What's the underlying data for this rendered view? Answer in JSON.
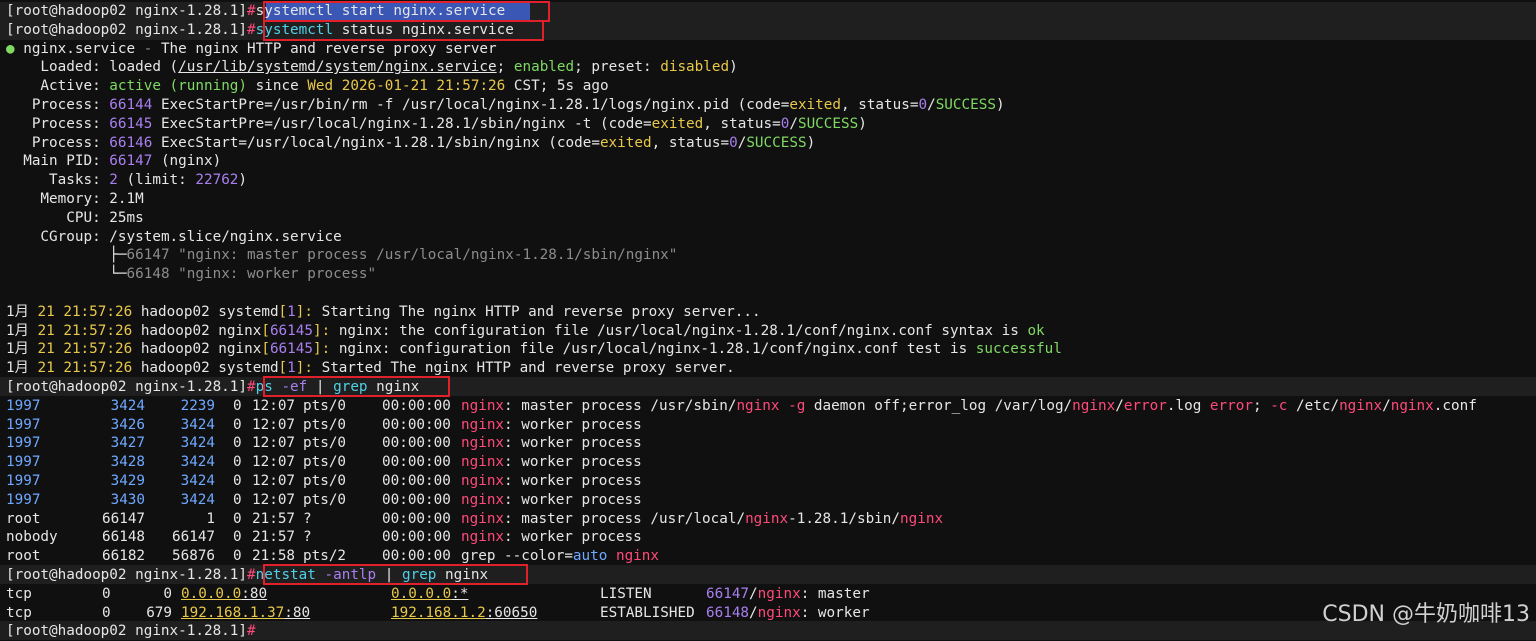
{
  "prompt": {
    "text": "[root@hadoop02 nginx-1.28.1]",
    "hash": "#"
  },
  "commands": [
    "systemctl start nginx.service",
    "systemctl status nginx.service",
    "ps -ef | grep nginx",
    "netstat -antlp | grep nginx"
  ],
  "status": {
    "dot": "●",
    "unit": "nginx.service",
    "dash": " - ",
    "description": "The nginx HTTP and reverse proxy server",
    "loaded_label": "Loaded:",
    "loaded_state": "loaded",
    "loaded_path": "/usr/lib/systemd/system/nginx.service",
    "loaded_enabled": "enabled",
    "loaded_preset": "preset: ",
    "loaded_preset_value": "disabled",
    "active_label": "Active:",
    "active_state": "active (running)",
    "active_since": "since ",
    "active_time": "Wed 2026-01-21 21:57:26",
    "active_tz": "CST; 5s ago",
    "process_label": "Process:",
    "processes": [
      {
        "pid": "66144",
        "cmd": "ExecStartPre=/usr/bin/rm -f /usr/local/nginx-1.28.1/logs/nginx.pid"
      },
      {
        "pid": "66145",
        "cmd": "ExecStartPre=/usr/local/nginx-1.28.1/sbin/nginx -t"
      },
      {
        "pid": "66146",
        "cmd": "ExecStart=/usr/local/nginx-1.28.1/sbin/nginx"
      }
    ],
    "code_label": "code=",
    "code_value": "exited",
    "status_label": "status=",
    "status_num": "0",
    "status_ok": "SUCCESS",
    "mainpid_label": "Main PID:",
    "mainpid": "66147",
    "mainpid_name": "(nginx)",
    "tasks_label": "Tasks:",
    "tasks": "2",
    "tasks_limit_label": "(limit: ",
    "tasks_limit": "22762",
    "memory_label": "Memory:",
    "memory": "2.1M",
    "cpu_label": "CPU:",
    "cpu": "25ms",
    "cgroup_label": "CGroup:",
    "cgroup": "/system.slice/nginx.service",
    "tree": [
      {
        "branch": "├─",
        "pid": "66147",
        "text": "\"nginx: master process /usr/local/nginx-1.28.1/sbin/nginx\""
      },
      {
        "branch": "└─",
        "pid": "66148",
        "text": "\"nginx: worker process\""
      }
    ]
  },
  "journal": [
    {
      "month": "1月",
      "day": "21",
      "time": "21:57:26",
      "host": "hadoop02",
      "unit": "systemd",
      "pid": "1",
      "msg": "Starting The nginx HTTP and reverse proxy server..."
    },
    {
      "month": "1月",
      "day": "21",
      "time": "21:57:26",
      "host": "hadoop02",
      "unit": "nginx",
      "pid": "66145",
      "msg": "nginx: the configuration file /usr/local/nginx-1.28.1/conf/nginx.conf syntax is ",
      "tail": "ok"
    },
    {
      "month": "1月",
      "day": "21",
      "time": "21:57:26",
      "host": "hadoop02",
      "unit": "nginx",
      "pid": "66145",
      "msg": "nginx: configuration file /usr/local/nginx-1.28.1/conf/nginx.conf test is ",
      "tail": "successful"
    },
    {
      "month": "1月",
      "day": "21",
      "time": "21:57:26",
      "host": "hadoop02",
      "unit": "systemd",
      "pid": "1",
      "msg": "Started The nginx HTTP and reverse proxy server."
    }
  ],
  "ps_rows": [
    {
      "uid": "1997",
      "pid": "3424",
      "ppid": "2239",
      "c": "0",
      "stime": "12:07",
      "tty": "pts/0",
      "time": "00:00:00",
      "cmd": "nginx: master process /usr/sbin/nginx -g daemon off;error_log /var/log/nginx/error.log error; -c /etc/nginx/nginx.conf"
    },
    {
      "uid": "1997",
      "pid": "3426",
      "ppid": "3424",
      "c": "0",
      "stime": "12:07",
      "tty": "pts/0",
      "time": "00:00:00",
      "cmd": "nginx: worker process"
    },
    {
      "uid": "1997",
      "pid": "3427",
      "ppid": "3424",
      "c": "0",
      "stime": "12:07",
      "tty": "pts/0",
      "time": "00:00:00",
      "cmd": "nginx: worker process"
    },
    {
      "uid": "1997",
      "pid": "3428",
      "ppid": "3424",
      "c": "0",
      "stime": "12:07",
      "tty": "pts/0",
      "time": "00:00:00",
      "cmd": "nginx: worker process"
    },
    {
      "uid": "1997",
      "pid": "3429",
      "ppid": "3424",
      "c": "0",
      "stime": "12:07",
      "tty": "pts/0",
      "time": "00:00:00",
      "cmd": "nginx: worker process"
    },
    {
      "uid": "1997",
      "pid": "3430",
      "ppid": "3424",
      "c": "0",
      "stime": "12:07",
      "tty": "pts/0",
      "time": "00:00:00",
      "cmd": "nginx: worker process"
    },
    {
      "uid": "root",
      "pid": "66147",
      "ppid": "1",
      "c": "0",
      "stime": "21:57",
      "tty": "?",
      "time": "00:00:00",
      "cmd": "nginx: master process /usr/local/nginx-1.28.1/sbin/nginx"
    },
    {
      "uid": "nobody",
      "pid": "66148",
      "ppid": "66147",
      "c": "0",
      "stime": "21:57",
      "tty": "?",
      "time": "00:00:00",
      "cmd": "nginx: worker process"
    },
    {
      "uid": "root",
      "pid": "66182",
      "ppid": "56876",
      "c": "0",
      "stime": "21:58",
      "tty": "pts/2",
      "time": "00:00:00",
      "cmd": "grep --color=auto nginx"
    }
  ],
  "netstat_rows": [
    {
      "proto": "tcp",
      "recvq": "0",
      "sendq": "0",
      "local": "0.0.0.0:80",
      "foreign": "0.0.0.0:*",
      "state": "LISTEN",
      "pid": "66147",
      "prog": "nginx",
      "role": "master"
    },
    {
      "proto": "tcp",
      "recvq": "0",
      "sendq": "679",
      "local": "192.168.1.37:80",
      "foreign": "192.168.1.2:60650",
      "state": "ESTABLISHED",
      "pid": "66148",
      "prog": "nginx",
      "role": "worker"
    }
  ],
  "watermark": "CSDN @牛奶咖啡13",
  "colors": {
    "background": "#101010",
    "prompt_row": "#1f1f1f",
    "highlight_box": "#e0202a",
    "selection": "#3b57b5",
    "green": "#7fd962",
    "yellow": "#e8c84a",
    "purple": "#a97ff0",
    "red": "#ff4a7a",
    "cyan": "#4fd1e8"
  }
}
